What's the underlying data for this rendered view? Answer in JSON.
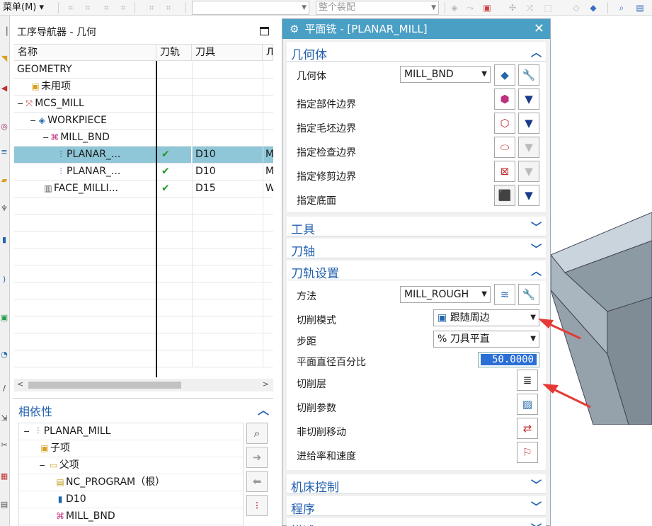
{
  "toolbar": {
    "menu_label": "菜单(M)",
    "assembly_combo_placeholder": "整个装配"
  },
  "navigator": {
    "title": "工序导航器 - 几何",
    "columns": [
      "名称",
      "刀轨",
      "刀具",
      "Л"
    ],
    "rows": [
      {
        "name": "GEOMETRY",
        "path": "",
        "tool": "",
        "more": "",
        "indent": 0,
        "icon": "none",
        "expander": ""
      },
      {
        "name": "未用项",
        "path": "",
        "tool": "",
        "more": "",
        "indent": 1,
        "icon": "folder-icon",
        "expander": ""
      },
      {
        "name": "MCS_MILL",
        "path": "",
        "tool": "",
        "more": "",
        "indent": 0,
        "icon": "mcs-icon",
        "expander": "−"
      },
      {
        "name": "WORKPIECE",
        "path": "",
        "tool": "",
        "more": "",
        "indent": 1,
        "icon": "workpiece-icon",
        "expander": "−"
      },
      {
        "name": "MILL_BND",
        "path": "",
        "tool": "",
        "more": "",
        "indent": 2,
        "icon": "boundary-icon",
        "expander": "−"
      },
      {
        "name": "PLANAR_...",
        "path": "✔",
        "tool": "D10",
        "more": "M",
        "indent": 3,
        "icon": "planar-mill-icon",
        "expander": ""
      },
      {
        "name": "PLANAR_...",
        "path": "✔",
        "tool": "D10",
        "more": "M",
        "indent": 3,
        "icon": "planar-mill-icon",
        "expander": ""
      },
      {
        "name": "FACE_MILLI...",
        "path": "✔",
        "tool": "D15",
        "more": "W",
        "indent": 2,
        "icon": "face-mill-icon",
        "expander": ""
      }
    ]
  },
  "dependency": {
    "title": "相依性",
    "rows": [
      {
        "label": "PLANAR_MILL",
        "indent": 0,
        "icon": "planar-mill-icon",
        "expander": "−"
      },
      {
        "label": "子项",
        "indent": 1,
        "icon": "folder-icon",
        "expander": ""
      },
      {
        "label": "父项",
        "indent": 1,
        "icon": "folder-open-icon",
        "expander": "−"
      },
      {
        "label": "NC_PROGRAM（根）",
        "indent": 2,
        "icon": "program-icon",
        "expander": ""
      },
      {
        "label": "D10",
        "indent": 2,
        "icon": "tool-icon",
        "expander": ""
      },
      {
        "label": "MILL_BND",
        "indent": 2,
        "icon": "boundary-icon",
        "expander": ""
      }
    ]
  },
  "dialog": {
    "title": "平面铣 - [PLANAR_MILL]",
    "geometry_section": "几何体",
    "geometry_label": "几何体",
    "geometry_value": "MILL_BND",
    "specify_part": "指定部件边界",
    "specify_blank": "指定毛坯边界",
    "specify_check": "指定检查边界",
    "specify_trim": "指定修剪边界",
    "specify_floor": "指定底面",
    "tool_section": "工具",
    "axis_section": "刀轴",
    "path_section": "刀轨设置",
    "method_label": "方法",
    "method_value": "MILL_ROUGH",
    "cut_pattern_label": "切削模式",
    "cut_pattern_value": "跟随周边",
    "stepover_label": "步距",
    "stepover_value": "% 刀具平直",
    "percent_label": "平面直径百分比",
    "percent_value": "50.0000",
    "cut_levels_label": "切削层",
    "cut_params_label": "切削参数",
    "noncut_label": "非切削移动",
    "feeds_label": "进给率和速度",
    "machine_section": "机床控制",
    "program_section": "程序",
    "desc_section": "描述"
  },
  "colors": {
    "dialog_title_bg": "#4a9fc4",
    "section_text": "#1f5fae",
    "selected_row": "#8fc6d8",
    "check_green": "#1f9a2a",
    "arrow_red": "#e53935"
  }
}
